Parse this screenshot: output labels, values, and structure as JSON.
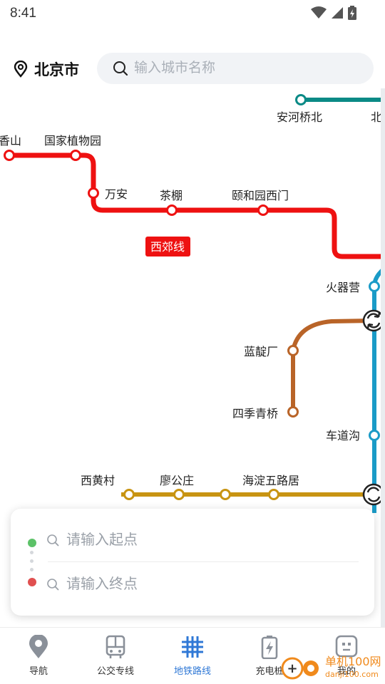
{
  "status": {
    "time": "8:41"
  },
  "header": {
    "city": "北京市",
    "search_placeholder": "输入城市名称"
  },
  "map": {
    "line_badge": "西郊线",
    "stations": {
      "anheqiaobei": "安河桥北",
      "bei": "北",
      "xiangshan": "香山",
      "zhiwuyuan": "国家植物园",
      "wanan": "万安",
      "chapeng": "茶棚",
      "yiheyuan": "颐和园西门",
      "huoqiying": "火器营",
      "landianchang": "蓝靛厂",
      "sijiqingqiao": "四季青桥",
      "chedaogou": "车道沟",
      "xihuangcun": "西黄村",
      "liaogongzhuang": "廖公庄",
      "haidianwulu": "海淀五路居"
    },
    "colors": {
      "xijiao": "#ee1111",
      "line4_teal": "#0a8a86",
      "line10": "#1a9bc7",
      "line_brown": "#b96428",
      "line6": "#c89412"
    }
  },
  "route": {
    "start_placeholder": "请输入起点",
    "end_placeholder": "请输入终点",
    "start_color": "#5cc268",
    "end_color": "#e05050"
  },
  "tabs": [
    {
      "label": "导航",
      "icon": "location-pin-icon"
    },
    {
      "label": "公交专线",
      "icon": "bus-icon"
    },
    {
      "label": "地铁路线",
      "icon": "subway-grid-icon",
      "active": true
    },
    {
      "label": "充电桩",
      "icon": "charging-icon"
    },
    {
      "label": "我的",
      "icon": "profile-icon"
    }
  ],
  "watermark": {
    "site": "单机100网",
    "url": "danji100.com"
  }
}
